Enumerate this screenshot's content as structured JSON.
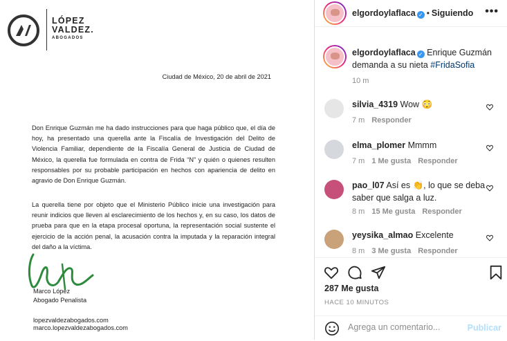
{
  "document": {
    "logo_line1": "LÓPEZ",
    "logo_line2": "VALDEZ.",
    "logo_sub": "ABOGADOS",
    "date": "Ciudad de México, 20 de abril de 2021",
    "paragraph1": "Don Enrique Guzmán me ha dado instrucciones para que haga público que, el día de hoy, ha presentado una querella ante la Fiscalía de Investigación del Delito de Violencia Familiar, dependiente de la Fiscalía General de Justicia de Ciudad de México, la querella fue formulada en contra de Frida “N” y quién o quienes resulten responsables por su probable participación en hechos con apariencia de delito en agravio de Don Enrique Guzmán.",
    "paragraph2": "La querella tiene por objeto que el Ministerio Público inicie una investigación para reunir indicios que lleven al esclarecimiento de los hechos y, en su caso, los datos de prueba para que en la etapa procesal oportuna, la representación social sustente el ejercicio de la acción penal, la acusación contra la imputada y la reparación integral del daño a la víctima.",
    "signer_name": "Marco López",
    "signer_title": "Abogado Penalista",
    "web": "lopezvaldezabogados.com",
    "email": "marco.lopezvaldezabogados.com"
  },
  "header": {
    "username": "elgordoylaflaca",
    "dot": "•",
    "follow_status": "Siguiendo",
    "more": "•••"
  },
  "caption": {
    "username": "elgordoylaflaca",
    "text": " Enrique Guzmán demanda a su nieta ",
    "hashtag": "#FridaSofia",
    "time": "10 m"
  },
  "comments": [
    {
      "user": "silvia_4319",
      "text": "Wow 😳",
      "time": "7 m",
      "likes": "",
      "reply": "Responder"
    },
    {
      "user": "elma_plomer",
      "text": "Mmmm",
      "time": "7 m",
      "likes": "1 Me gusta",
      "reply": "Responder"
    },
    {
      "user": "pao_l07",
      "text": "Así es 👏, lo que se deba saber que salga a luz.",
      "time": "8 m",
      "likes": "15 Me gusta",
      "reply": "Responder"
    },
    {
      "user": "yeysika_almao",
      "text": "Excelente",
      "time": "8 m",
      "likes": "3 Me gusta",
      "reply": "Responder"
    }
  ],
  "actions": {
    "likes": "287 Me gusta",
    "posted": "HACE 10 MINUTOS"
  },
  "add_comment": {
    "placeholder": "Agrega un comentario...",
    "publish": "Publicar"
  },
  "colors": {
    "verified": "#3897f0",
    "hashtag": "#00376b",
    "muted": "#8e8e8e",
    "publish_disabled": "#b2dffc",
    "signature": "#2e8b3e"
  }
}
